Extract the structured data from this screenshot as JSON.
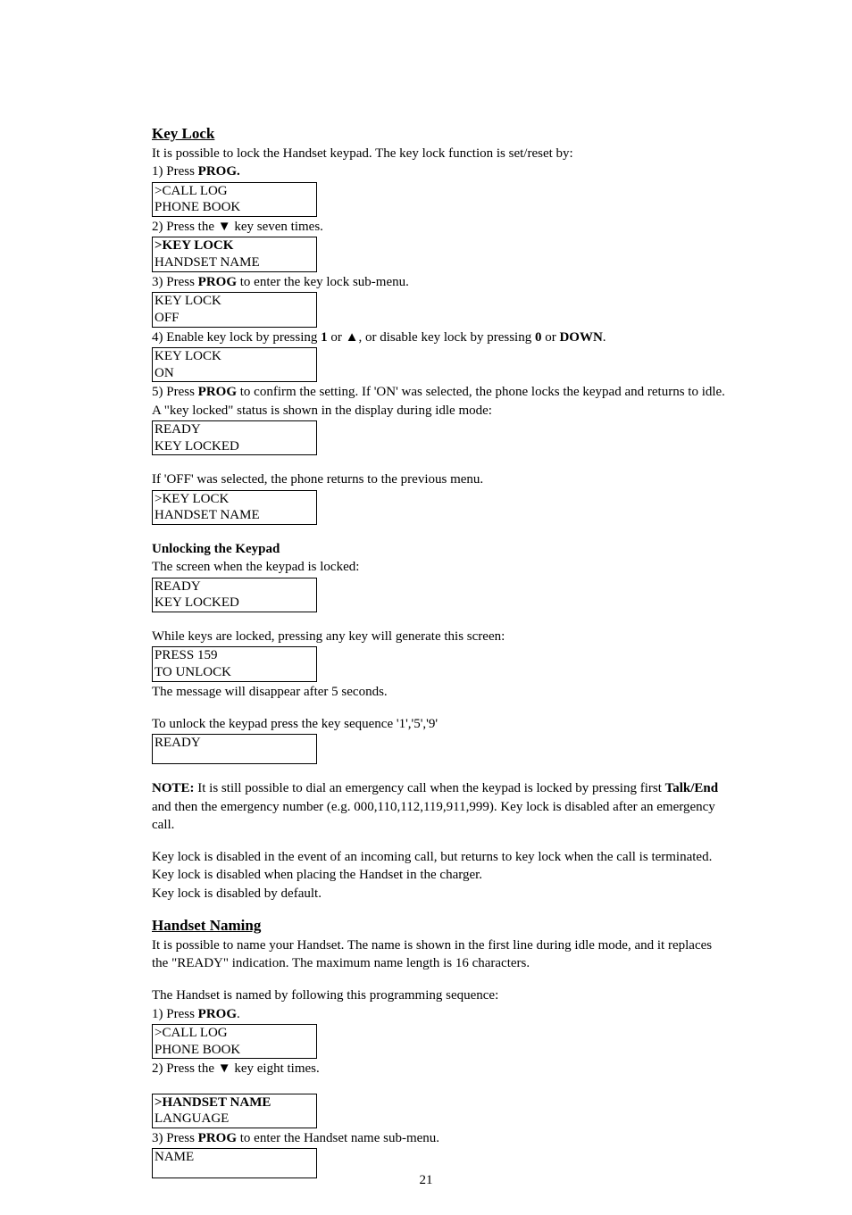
{
  "pageNumber": "21",
  "keylock": {
    "title": "Key Lock",
    "intro": "It is possible to lock the Handset keypad. The key lock function is set/reset by:",
    "step1_pre": "1) Press ",
    "step1_prog": "PROG.",
    "box1_l1": ">CALL LOG",
    "box1_l2": " PHONE BOOK",
    "step2_pre": "2) Press the ",
    "step2_arrow": "▼",
    "step2_post": " key seven times.",
    "box2_l1": ">KEY LOCK",
    "box2_l2": " HANDSET NAME",
    "step3_pre": "3) Press ",
    "step3_prog": "PROG",
    "step3_post": " to enter the key lock sub-menu.",
    "box3_l1": "KEY LOCK",
    "box3_l2": "OFF",
    "step4_pre": "4) Enable key lock by pressing ",
    "step4_one": "1",
    "step4_or1": " or ",
    "step4_up": "▲",
    "step4_mid": ", or disable key lock by pressing ",
    "step4_zero": "0",
    "step4_or2": " or ",
    "step4_down": "DOWN",
    "step4_end": ".",
    "box4_l1": "KEY LOCK",
    "box4_l2": "ON",
    "step5_pre": "5) Press ",
    "step5_prog": "PROG",
    "step5_post": " to confirm the setting. If 'ON' was selected, the phone locks the keypad and returns to idle. A \"key locked\" status is shown in the display during idle mode:",
    "box5_l1": "READY",
    "box5_l2": "KEY LOCKED",
    "offSelected": "If 'OFF' was selected, the phone returns to the previous menu.",
    "box6_l1": ">KEY LOCK",
    "box6_l2": " HANDSET NAME",
    "unlockTitle": "Unlocking the Keypad",
    "unlock1": "The screen when the keypad is locked:",
    "box7_l1": "READY",
    "box7_l2": "KEY LOCKED",
    "unlock2": "While keys are locked, pressing any key will generate this screen:",
    "box8_l1": "PRESS 159",
    "box8_l2": "TO UNLOCK",
    "unlock3": "The message will disappear after 5 seconds.",
    "unlock4": "To unlock the keypad press the key sequence '1','5','9'",
    "box9_l1": "READY",
    "box9_l2": " ",
    "note_label": "NOTE:",
    "note_text": " It is still possible to dial an emergency call when the keypad is locked by pressing first ",
    "note_talk": "Talk/End",
    "note_text2": " and then the emergency number (e.g. 000,110,112,119,911,999). Key lock is disabled after an emergency call.",
    "tail1": "Key lock is disabled in the event of an incoming call, but returns to key lock when the call is terminated.",
    "tail2": "Key lock is disabled when placing the Handset in the charger.",
    "tail3": "Key lock is disabled by default."
  },
  "handset": {
    "title": "Handset Naming",
    "intro": "It is possible to name your Handset. The name is shown in the first line during idle mode, and it replaces the \"READY\" indication.  The maximum name length is 16 characters.",
    "seq": "The Handset is named by following this programming sequence:",
    "step1_pre": "1) Press ",
    "step1_prog": "PROG",
    "step1_end": ".",
    "box1_l1": ">CALL LOG",
    "box1_l2": " PHONE BOOK",
    "step2_pre": "2) Press the ",
    "step2_arrow": "▼",
    "step2_post": " key eight times.",
    "box2_l1": ">HANDSET NAME",
    "box2_l2": " LANGUAGE",
    "step3_pre": "3) Press ",
    "step3_prog": "PROG",
    "step3_post": " to enter the Handset name sub-menu.",
    "box3_l1": "NAME",
    "box3_l2": " "
  }
}
